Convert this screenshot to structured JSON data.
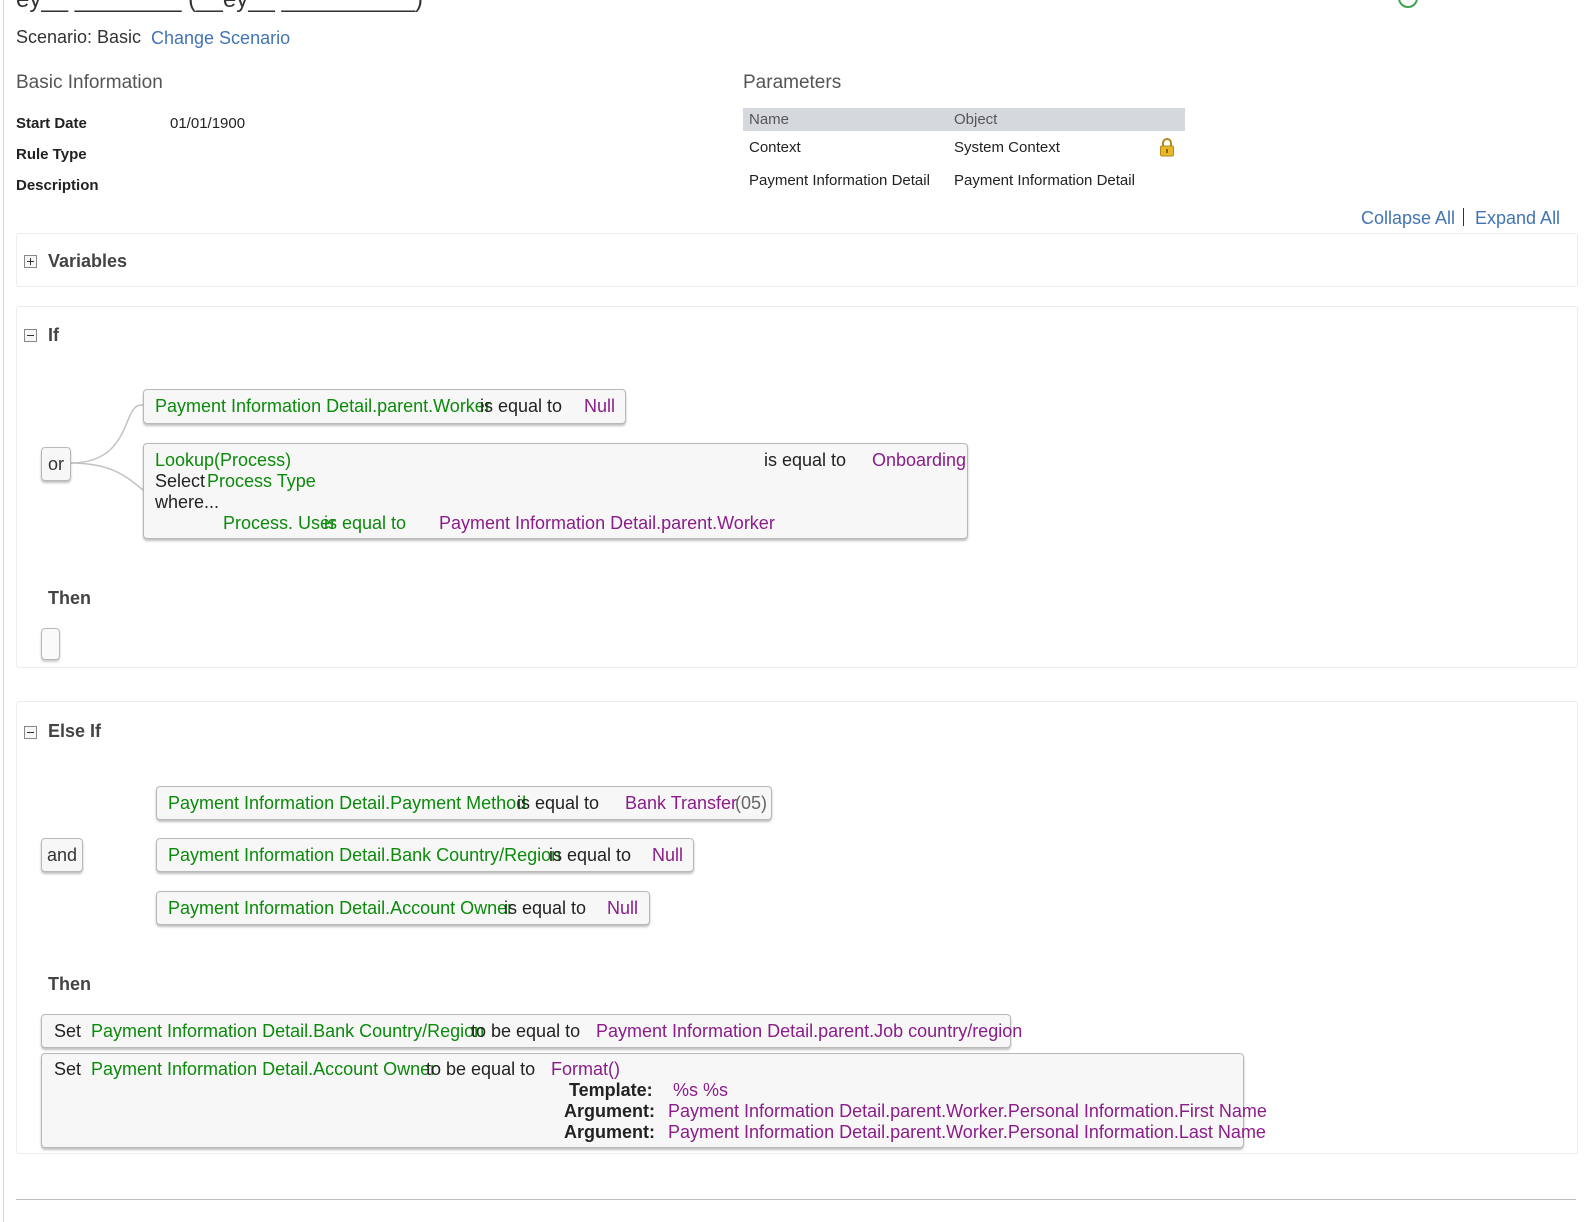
{
  "header": {
    "title": "ey__ ________ (__ey__ __________)",
    "scenario_label": "Scenario: Basic",
    "change_scenario": "Change Scenario"
  },
  "basic_info": {
    "title": "Basic Information",
    "start_date_label": "Start Date",
    "start_date_value": "01/01/1900",
    "rule_type_label": "Rule Type",
    "description_label": "Description"
  },
  "parameters": {
    "title": "Parameters",
    "col_name": "Name",
    "col_object": "Object",
    "rows": [
      {
        "name": "Context",
        "object": "System Context"
      },
      {
        "name": "Payment Information Detail",
        "object": "Payment Information Detail"
      }
    ]
  },
  "links": {
    "collapse_all": "Collapse All",
    "expand_all": "Expand All"
  },
  "variables": {
    "title": "Variables"
  },
  "if_block": {
    "title": "If",
    "operator": "or",
    "cond1": {
      "field": "Payment Information Detail.parent.Worker",
      "op": "is equal to",
      "value": "Null"
    },
    "cond2": {
      "field": "Lookup(Process)",
      "op": "is equal to",
      "value": "Onboarding",
      "select_kw": "Select",
      "select_field": "Process Type",
      "where_kw": "where...",
      "where_field": "Process. User",
      "where_op": "is equal to",
      "where_value": "Payment Information Detail.parent.Worker"
    },
    "then_label": "Then"
  },
  "else_if_block": {
    "title": "Else If",
    "operator": "and",
    "cond1": {
      "field": "Payment Information Detail.Payment Method",
      "op": "is equal to",
      "value": "Bank Transfer",
      "code": "(05)"
    },
    "cond2": {
      "field": "Payment Information Detail.Bank Country/Region",
      "op": "is equal to",
      "value": "Null"
    },
    "cond3": {
      "field": "Payment Information Detail.Account Owner",
      "op": "is equal to",
      "value": "Null"
    },
    "then_label": "Then",
    "action1": {
      "set": "Set",
      "field": "Payment Information Detail.Bank Country/Region",
      "op": "to be equal to",
      "value": "Payment Information Detail.parent.Job country/region"
    },
    "action2": {
      "set": "Set",
      "field": "Payment Information Detail.Account Owner",
      "op": "to be equal to",
      "func": "Format()",
      "template_label": "Template:",
      "template_value": "%s %s",
      "arg_label_1": "Argument:",
      "arg_value_1": "Payment Information Detail.parent.Worker.Personal Information.First Name",
      "arg_label_2": "Argument:",
      "arg_value_2": "Payment Information Detail.parent.Worker.Personal Information.Last Name"
    }
  },
  "colors": {
    "link": "#4274b5",
    "field_green": "#0b8a0b",
    "value_purple": "#8a1d8a",
    "status_green": "#3fa34d"
  }
}
